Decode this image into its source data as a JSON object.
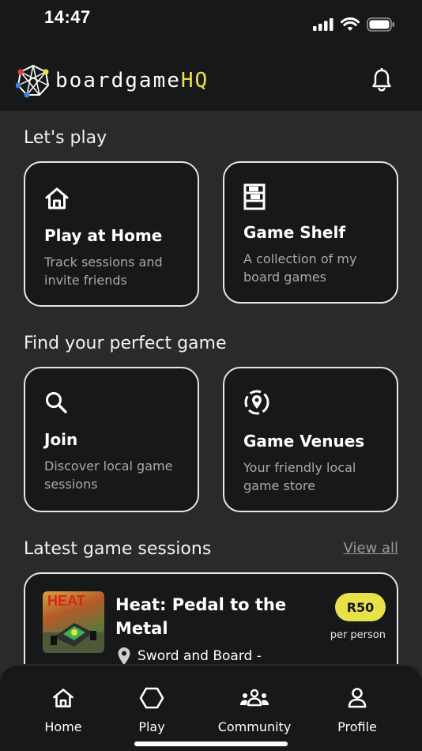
{
  "status_bar": {
    "time": "14:47"
  },
  "header": {
    "logo_main": "boardgame",
    "logo_accent": "HQ",
    "accent_color": "#e9e64a"
  },
  "lets_play": {
    "title": "Let's play",
    "cards": [
      {
        "icon": "home-icon",
        "title": "Play at Home",
        "description": "Track sessions and invite friends"
      },
      {
        "icon": "shelf-icon",
        "title": "Game Shelf",
        "description": "A collection of my board games"
      }
    ]
  },
  "find_game": {
    "title": "Find your perfect game",
    "cards": [
      {
        "icon": "search-icon",
        "title": "Join",
        "description": "Discover local game sessions"
      },
      {
        "icon": "location-pin-icon",
        "title": "Game Venues",
        "description": "Your friendly local game store"
      }
    ]
  },
  "latest_sessions": {
    "title": "Latest game sessions",
    "view_all": "View all",
    "items": [
      {
        "thumbnail_text": "HEAT",
        "title": "Heat: Pedal to the Metal",
        "venue": "Sword and Board -",
        "price": "R50",
        "price_unit": "per person",
        "badge_color": "#e8e24a"
      }
    ]
  },
  "tab_bar": {
    "tabs": [
      {
        "icon": "home-icon",
        "label": "Home"
      },
      {
        "icon": "hexagon-icon",
        "label": "Play"
      },
      {
        "icon": "community-icon",
        "label": "Community"
      },
      {
        "icon": "person-icon",
        "label": "Profile"
      }
    ]
  }
}
